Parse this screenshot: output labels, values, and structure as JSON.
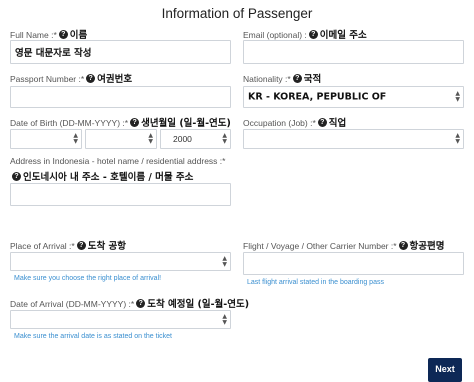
{
  "title": "Information of Passenger",
  "help_icon": "question-circle-icon",
  "full_name": {
    "label": "Full Name :*",
    "label_ko": "이름",
    "value": "영문 대문자로 작성"
  },
  "email": {
    "label": "Email (optional) :",
    "label_ko": "이메일 주소",
    "value": ""
  },
  "passport": {
    "label": "Passport Number :*",
    "label_ko": "여권번호",
    "value": ""
  },
  "nationality": {
    "label": "Nationality :*",
    "label_ko": "국적",
    "value": "KR - KOREA, PEPUBLIC OF"
  },
  "dob": {
    "label": "Date of Birth (DD-MM-YYYY) :*",
    "label_ko": "생년월일 (일-월-연도)",
    "day": "",
    "month": "",
    "year": "2000"
  },
  "occupation": {
    "label": "Occupation (Job) :*",
    "label_ko": "직업",
    "value": ""
  },
  "address": {
    "label": "Address in Indonesia - hotel name / residential address :*",
    "label_ko": "인도네시아 내 주소 - 호텔이름 / 머물 주소",
    "value": ""
  },
  "place_of_arrival": {
    "label": "Place of Arrival :*",
    "label_ko": "도착 공항",
    "value": "",
    "hint": "Make sure you choose the right place of arrival!"
  },
  "flight": {
    "label": "Flight / Voyage / Other Carrier Number :*",
    "label_ko": "항공편명",
    "value": "",
    "hint": "Last flight arrival stated in the boarding pass"
  },
  "date_of_arrival": {
    "label": "Date of Arrival (DD-MM-YYYY) :*",
    "label_ko": "도착 예정일 (일-월-연도)",
    "value": "",
    "hint": "Make sure the arrival date is as stated on the ticket"
  },
  "next_label": "Next",
  "colors": {
    "hint": "#3a8fd0",
    "next_button": "#0d2856",
    "border": "#cfd4da"
  }
}
